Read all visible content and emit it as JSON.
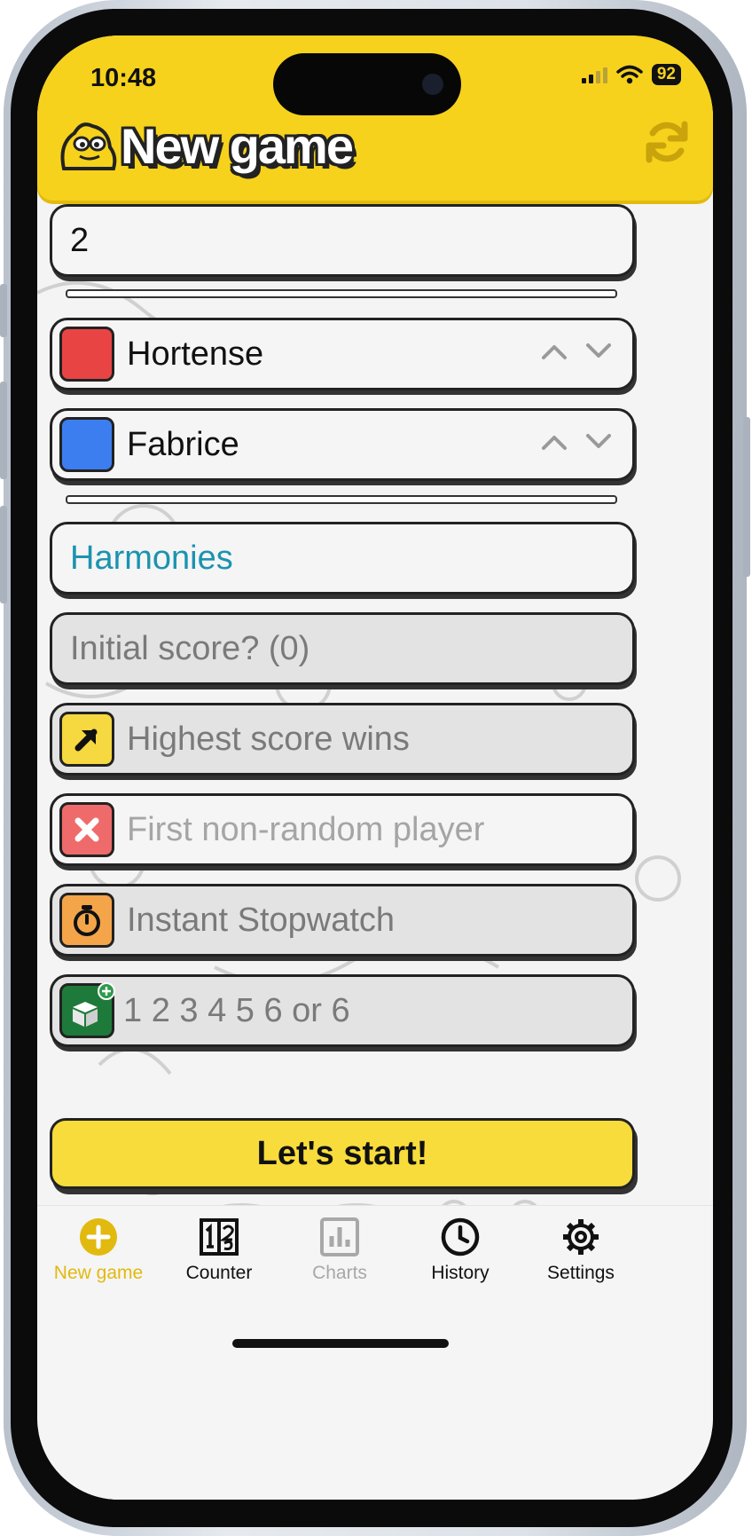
{
  "status": {
    "time": "10:48",
    "battery": "92"
  },
  "header": {
    "title": "New game",
    "logo_icon": "mascot-icon",
    "refresh_icon": "refresh-icon"
  },
  "players_count": {
    "value": "2"
  },
  "players": [
    {
      "name": "Hortense",
      "color": "#e94444"
    },
    {
      "name": "Fabrice",
      "color": "#3c7ef0"
    }
  ],
  "game_name": {
    "value": "Harmonies"
  },
  "initial_score": {
    "placeholder": "Initial score? (0)"
  },
  "options": {
    "win_rule": {
      "label": "Highest score wins",
      "icon": "arrow-up-right-icon",
      "color": "#f6d840"
    },
    "first_player": {
      "label": "First non-random player",
      "icon": "close-icon",
      "color": "#ef6b6b"
    },
    "stopwatch": {
      "label": "Instant Stopwatch",
      "icon": "stopwatch-icon",
      "color": "#f4a54a"
    },
    "dice": {
      "label": "1 2 3 4 5 6 or 6",
      "icon": "dice-icon",
      "color": "#1e7a3a"
    }
  },
  "start_button": {
    "label": "Let's start!"
  },
  "tabs": [
    {
      "label": "New game",
      "icon": "plus-circle-icon",
      "state": "active"
    },
    {
      "label": "Counter",
      "icon": "counter-icon",
      "state": "normal"
    },
    {
      "label": "Charts",
      "icon": "chart-icon",
      "state": "disabled"
    },
    {
      "label": "History",
      "icon": "clock-icon",
      "state": "normal"
    },
    {
      "label": "Settings",
      "icon": "gear-icon",
      "state": "normal"
    }
  ],
  "colors": {
    "accent": "#f6d21c",
    "active_tab": "#e2b90f",
    "disabled_tab": "#a8a8a8"
  }
}
